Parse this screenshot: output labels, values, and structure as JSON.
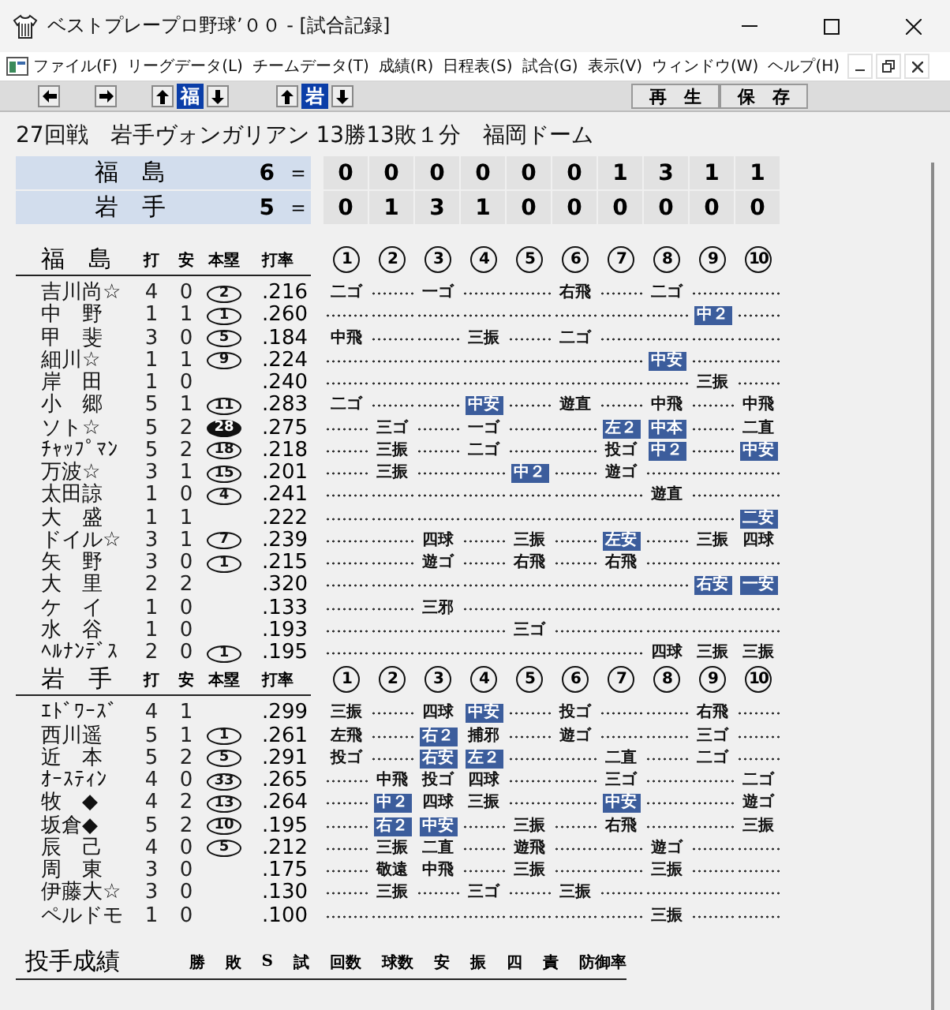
{
  "window": {
    "title": "ベストプレープロ野球’００ - [試合記録]"
  },
  "menu": [
    "ファイル(F)",
    "リーグデータ(L)",
    "チームデータ(T)",
    "成績(R)",
    "日程表(S)",
    "試合(G)",
    "表示(V)",
    "ウィンドウ(W)",
    "ヘルプ(H)"
  ],
  "toolbar": {
    "team_buttons": [
      "福",
      "岩"
    ],
    "actions": [
      "再　生",
      "保　存"
    ]
  },
  "game_info": "27回戦　岩手ヴォンガリアン 13勝13敗１分　福岡ドーム",
  "scoreboard": [
    {
      "team": "福　島",
      "runs": "6",
      "equals": "＝",
      "innings": [
        "0",
        "0",
        "0",
        "0",
        "0",
        "0",
        "1",
        "3",
        "1",
        "1"
      ]
    },
    {
      "team": "岩　手",
      "runs": "5",
      "equals": "＝",
      "innings": [
        "0",
        "1",
        "3",
        "1",
        "0",
        "0",
        "0",
        "0",
        "0",
        "0"
      ]
    }
  ],
  "batting": [
    {
      "team": "福　島",
      "columns": [
        "打",
        "安",
        "本塁",
        "打率"
      ],
      "innings": [
        "1",
        "2",
        "3",
        "4",
        "5",
        "6",
        "7",
        "8",
        "9",
        "10"
      ],
      "rows": [
        {
          "name": "吉川尚☆",
          "ab": "4",
          "h": "0",
          "hr": {
            "text": "2",
            "filled": false
          },
          "avg": ".216",
          "plays": [
            {
              "kind": "play",
              "text": "二ゴ",
              "hit": false
            },
            {
              "kind": "dots"
            },
            {
              "kind": "play",
              "text": "一ゴ",
              "hit": false
            },
            {
              "kind": "dots"
            },
            {
              "kind": "dots"
            },
            {
              "kind": "play",
              "text": "右飛",
              "hit": false
            },
            {
              "kind": "dots"
            },
            {
              "kind": "play",
              "text": "二ゴ",
              "hit": false
            },
            {
              "kind": "dots"
            },
            {
              "kind": "dots"
            }
          ]
        },
        {
          "name": "中　野",
          "ab": "1",
          "h": "1",
          "hr": {
            "text": "1",
            "filled": false
          },
          "avg": ".260",
          "plays": [
            {
              "kind": "dots"
            },
            {
              "kind": "dots"
            },
            {
              "kind": "dots"
            },
            {
              "kind": "dots"
            },
            {
              "kind": "dots"
            },
            {
              "kind": "dots"
            },
            {
              "kind": "dots"
            },
            {
              "kind": "dots"
            },
            {
              "kind": "play",
              "text": "中２",
              "hit": true
            },
            {
              "kind": "dots"
            }
          ]
        },
        {
          "name": "甲　斐",
          "ab": "3",
          "h": "0",
          "hr": {
            "text": "5",
            "filled": false
          },
          "avg": ".184",
          "plays": [
            {
              "kind": "play",
              "text": "中飛",
              "hit": false
            },
            {
              "kind": "dots"
            },
            {
              "kind": "dots"
            },
            {
              "kind": "play",
              "text": "三振",
              "hit": false
            },
            {
              "kind": "dots"
            },
            {
              "kind": "play",
              "text": "二ゴ",
              "hit": false
            },
            {
              "kind": "dots"
            },
            {
              "kind": "dots"
            },
            {
              "kind": "dots"
            },
            {
              "kind": "dots"
            }
          ]
        },
        {
          "name": "細川☆",
          "ab": "1",
          "h": "1",
          "hr": {
            "text": "9",
            "filled": false
          },
          "avg": ".224",
          "plays": [
            {
              "kind": "dots"
            },
            {
              "kind": "dots"
            },
            {
              "kind": "dots"
            },
            {
              "kind": "dots"
            },
            {
              "kind": "dots"
            },
            {
              "kind": "dots"
            },
            {
              "kind": "dots"
            },
            {
              "kind": "play",
              "text": "中安",
              "hit": true
            },
            {
              "kind": "dots"
            },
            {
              "kind": "dots"
            }
          ]
        },
        {
          "name": "岸　田",
          "ab": "1",
          "h": "0",
          "avg": ".240",
          "plays": [
            {
              "kind": "dots"
            },
            {
              "kind": "dots"
            },
            {
              "kind": "dots"
            },
            {
              "kind": "dots"
            },
            {
              "kind": "dots"
            },
            {
              "kind": "dots"
            },
            {
              "kind": "dots"
            },
            {
              "kind": "dots"
            },
            {
              "kind": "play",
              "text": "三振",
              "hit": false
            },
            {
              "kind": "dots"
            }
          ]
        },
        {
          "name": "小　郷",
          "ab": "5",
          "h": "1",
          "hr": {
            "text": "11",
            "filled": false
          },
          "avg": ".283",
          "plays": [
            {
              "kind": "play",
              "text": "二ゴ",
              "hit": false
            },
            {
              "kind": "dots"
            },
            {
              "kind": "dots"
            },
            {
              "kind": "play",
              "text": "中安",
              "hit": true
            },
            {
              "kind": "dots"
            },
            {
              "kind": "play",
              "text": "遊直",
              "hit": false
            },
            {
              "kind": "dots"
            },
            {
              "kind": "play",
              "text": "中飛",
              "hit": false
            },
            {
              "kind": "dots"
            },
            {
              "kind": "play",
              "text": "中飛",
              "hit": false
            }
          ]
        },
        {
          "name": "ソト☆",
          "ab": "5",
          "h": "2",
          "hr": {
            "text": "28",
            "filled": true
          },
          "avg": ".275",
          "plays": [
            {
              "kind": "dots"
            },
            {
              "kind": "play",
              "text": "三ゴ",
              "hit": false
            },
            {
              "kind": "dots"
            },
            {
              "kind": "play",
              "text": "一ゴ",
              "hit": false
            },
            {
              "kind": "dots"
            },
            {
              "kind": "dots"
            },
            {
              "kind": "play",
              "text": "左２",
              "hit": true
            },
            {
              "kind": "play",
              "text": "中本",
              "hit": true
            },
            {
              "kind": "dots"
            },
            {
              "kind": "play",
              "text": "二直",
              "hit": false
            }
          ]
        },
        {
          "name": "ﾁｬｯﾌﾟﾏﾝ",
          "ab": "5",
          "h": "2",
          "hr": {
            "text": "18",
            "filled": false
          },
          "avg": ".218",
          "plays": [
            {
              "kind": "dots"
            },
            {
              "kind": "play",
              "text": "三振",
              "hit": false
            },
            {
              "kind": "dots"
            },
            {
              "kind": "play",
              "text": "二ゴ",
              "hit": false
            },
            {
              "kind": "dots"
            },
            {
              "kind": "dots"
            },
            {
              "kind": "play",
              "text": "投ゴ",
              "hit": false
            },
            {
              "kind": "play",
              "text": "中２",
              "hit": true
            },
            {
              "kind": "dots"
            },
            {
              "kind": "play",
              "text": "中安",
              "hit": true
            }
          ]
        },
        {
          "name": "万波☆",
          "ab": "3",
          "h": "1",
          "hr": {
            "text": "15",
            "filled": false
          },
          "avg": ".201",
          "plays": [
            {
              "kind": "dots"
            },
            {
              "kind": "play",
              "text": "三振",
              "hit": false
            },
            {
              "kind": "dots"
            },
            {
              "kind": "dots"
            },
            {
              "kind": "play",
              "text": "中２",
              "hit": true
            },
            {
              "kind": "dots"
            },
            {
              "kind": "play",
              "text": "遊ゴ",
              "hit": false
            },
            {
              "kind": "dots"
            },
            {
              "kind": "dots"
            },
            {
              "kind": "dots"
            }
          ]
        },
        {
          "name": "太田諒",
          "ab": "1",
          "h": "0",
          "hr": {
            "text": "4",
            "filled": false
          },
          "avg": ".241",
          "plays": [
            {
              "kind": "dots"
            },
            {
              "kind": "dots"
            },
            {
              "kind": "dots"
            },
            {
              "kind": "dots"
            },
            {
              "kind": "dots"
            },
            {
              "kind": "dots"
            },
            {
              "kind": "dots"
            },
            {
              "kind": "play",
              "text": "遊直",
              "hit": false
            },
            {
              "kind": "dots"
            },
            {
              "kind": "dots"
            }
          ]
        },
        {
          "name": "大　盛",
          "ab": "1",
          "h": "1",
          "avg": ".222",
          "plays": [
            {
              "kind": "dots"
            },
            {
              "kind": "dots"
            },
            {
              "kind": "dots"
            },
            {
              "kind": "dots"
            },
            {
              "kind": "dots"
            },
            {
              "kind": "dots"
            },
            {
              "kind": "dots"
            },
            {
              "kind": "dots"
            },
            {
              "kind": "dots"
            },
            {
              "kind": "play",
              "text": "二安",
              "hit": true
            }
          ]
        },
        {
          "name": "ドイル☆",
          "ab": "3",
          "h": "1",
          "hr": {
            "text": "7",
            "filled": false
          },
          "avg": ".239",
          "plays": [
            {
              "kind": "dots"
            },
            {
              "kind": "dots"
            },
            {
              "kind": "play",
              "text": "四球",
              "hit": false
            },
            {
              "kind": "dots"
            },
            {
              "kind": "play",
              "text": "三振",
              "hit": false
            },
            {
              "kind": "dots"
            },
            {
              "kind": "play",
              "text": "左安",
              "hit": true
            },
            {
              "kind": "dots"
            },
            {
              "kind": "play",
              "text": "三振",
              "hit": false
            },
            {
              "kind": "play",
              "text": "四球",
              "hit": false
            }
          ]
        },
        {
          "name": "矢　野",
          "ab": "3",
          "h": "0",
          "hr": {
            "text": "1",
            "filled": false
          },
          "avg": ".215",
          "plays": [
            {
              "kind": "dots"
            },
            {
              "kind": "dots"
            },
            {
              "kind": "play",
              "text": "遊ゴ",
              "hit": false
            },
            {
              "kind": "dots"
            },
            {
              "kind": "play",
              "text": "右飛",
              "hit": false
            },
            {
              "kind": "dots"
            },
            {
              "kind": "play",
              "text": "右飛",
              "hit": false
            },
            {
              "kind": "dots"
            },
            {
              "kind": "dots"
            },
            {
              "kind": "dots"
            }
          ]
        },
        {
          "name": "大　里",
          "ab": "2",
          "h": "2",
          "avg": ".320",
          "plays": [
            {
              "kind": "dots"
            },
            {
              "kind": "dots"
            },
            {
              "kind": "dots"
            },
            {
              "kind": "dots"
            },
            {
              "kind": "dots"
            },
            {
              "kind": "dots"
            },
            {
              "kind": "dots"
            },
            {
              "kind": "dots"
            },
            {
              "kind": "play",
              "text": "右安",
              "hit": true
            },
            {
              "kind": "play",
              "text": "一安",
              "hit": true
            }
          ]
        },
        {
          "name": "ケ　イ",
          "ab": "1",
          "h": "0",
          "avg": ".133",
          "plays": [
            {
              "kind": "dots"
            },
            {
              "kind": "dots"
            },
            {
              "kind": "play",
              "text": "三邪",
              "hit": false
            },
            {
              "kind": "dots"
            },
            {
              "kind": "dots"
            },
            {
              "kind": "dots"
            },
            {
              "kind": "dots"
            },
            {
              "kind": "dots"
            },
            {
              "kind": "dots"
            },
            {
              "kind": "dots"
            }
          ]
        },
        {
          "name": "水　谷",
          "ab": "1",
          "h": "0",
          "avg": ".193",
          "plays": [
            {
              "kind": "dots"
            },
            {
              "kind": "dots"
            },
            {
              "kind": "dots"
            },
            {
              "kind": "dots"
            },
            {
              "kind": "play",
              "text": "三ゴ",
              "hit": false
            },
            {
              "kind": "dots"
            },
            {
              "kind": "dots"
            },
            {
              "kind": "dots"
            },
            {
              "kind": "dots"
            },
            {
              "kind": "dots"
            }
          ]
        },
        {
          "name": "ﾍﾙﾅﾝﾃﾞｽ",
          "ab": "2",
          "h": "0",
          "hr": {
            "text": "1",
            "filled": false
          },
          "avg": ".195",
          "plays": [
            {
              "kind": "dots"
            },
            {
              "kind": "dots"
            },
            {
              "kind": "dots"
            },
            {
              "kind": "dots"
            },
            {
              "kind": "dots"
            },
            {
              "kind": "dots"
            },
            {
              "kind": "dots"
            },
            {
              "kind": "play",
              "text": "四球",
              "hit": false
            },
            {
              "kind": "play",
              "text": "三振",
              "hit": false
            },
            {
              "kind": "play",
              "text": "三振",
              "hit": false
            }
          ]
        }
      ]
    },
    {
      "team": "岩　手",
      "columns": [
        "打",
        "安",
        "本塁",
        "打率"
      ],
      "innings": [
        "1",
        "2",
        "3",
        "4",
        "5",
        "6",
        "7",
        "8",
        "9",
        "10"
      ],
      "rows": [
        {
          "name": "ｴﾄﾞﾜｰｽﾞ",
          "ab": "4",
          "h": "1",
          "avg": ".299",
          "plays": [
            {
              "kind": "play",
              "text": "三振",
              "hit": false
            },
            {
              "kind": "dots"
            },
            {
              "kind": "play",
              "text": "四球",
              "hit": false
            },
            {
              "kind": "play",
              "text": "中安",
              "hit": true
            },
            {
              "kind": "dots"
            },
            {
              "kind": "play",
              "text": "投ゴ",
              "hit": false
            },
            {
              "kind": "dots"
            },
            {
              "kind": "dots"
            },
            {
              "kind": "play",
              "text": "右飛",
              "hit": false
            },
            {
              "kind": "dots"
            }
          ]
        },
        {
          "name": "西川遥",
          "ab": "5",
          "h": "1",
          "hr": {
            "text": "1",
            "filled": false
          },
          "avg": ".261",
          "plays": [
            {
              "kind": "play",
              "text": "左飛",
              "hit": false
            },
            {
              "kind": "dots"
            },
            {
              "kind": "play",
              "text": "右２",
              "hit": true
            },
            {
              "kind": "play",
              "text": "捕邪",
              "hit": false
            },
            {
              "kind": "dots"
            },
            {
              "kind": "play",
              "text": "遊ゴ",
              "hit": false
            },
            {
              "kind": "dots"
            },
            {
              "kind": "dots"
            },
            {
              "kind": "play",
              "text": "三ゴ",
              "hit": false
            },
            {
              "kind": "dots"
            }
          ]
        },
        {
          "name": "近　本",
          "ab": "5",
          "h": "2",
          "hr": {
            "text": "5",
            "filled": false
          },
          "avg": ".291",
          "plays": [
            {
              "kind": "play",
              "text": "投ゴ",
              "hit": false
            },
            {
              "kind": "dots"
            },
            {
              "kind": "play",
              "text": "右安",
              "hit": true
            },
            {
              "kind": "play",
              "text": "左２",
              "hit": true
            },
            {
              "kind": "dots"
            },
            {
              "kind": "dots"
            },
            {
              "kind": "play",
              "text": "二直",
              "hit": false
            },
            {
              "kind": "dots"
            },
            {
              "kind": "play",
              "text": "二ゴ",
              "hit": false
            },
            {
              "kind": "dots"
            }
          ]
        },
        {
          "name": "ｵｰｽﾃｨﾝ",
          "ab": "4",
          "h": "0",
          "hr": {
            "text": "33",
            "filled": false
          },
          "avg": ".265",
          "plays": [
            {
              "kind": "dots"
            },
            {
              "kind": "play",
              "text": "中飛",
              "hit": false
            },
            {
              "kind": "play",
              "text": "投ゴ",
              "hit": false
            },
            {
              "kind": "play",
              "text": "四球",
              "hit": false
            },
            {
              "kind": "dots"
            },
            {
              "kind": "dots"
            },
            {
              "kind": "play",
              "text": "三ゴ",
              "hit": false
            },
            {
              "kind": "dots"
            },
            {
              "kind": "dots"
            },
            {
              "kind": "play",
              "text": "二ゴ",
              "hit": false
            }
          ]
        },
        {
          "name": "牧　◆",
          "ab": "4",
          "h": "2",
          "hr": {
            "text": "13",
            "filled": false
          },
          "avg": ".264",
          "plays": [
            {
              "kind": "dots"
            },
            {
              "kind": "play",
              "text": "中２",
              "hit": true
            },
            {
              "kind": "play",
              "text": "四球",
              "hit": false
            },
            {
              "kind": "play",
              "text": "三振",
              "hit": false
            },
            {
              "kind": "dots"
            },
            {
              "kind": "dots"
            },
            {
              "kind": "play",
              "text": "中安",
              "hit": true
            },
            {
              "kind": "dots"
            },
            {
              "kind": "dots"
            },
            {
              "kind": "play",
              "text": "遊ゴ",
              "hit": false
            }
          ]
        },
        {
          "name": "坂倉◆",
          "ab": "5",
          "h": "2",
          "hr": {
            "text": "10",
            "filled": false
          },
          "avg": ".195",
          "plays": [
            {
              "kind": "dots"
            },
            {
              "kind": "play",
              "text": "右２",
              "hit": true
            },
            {
              "kind": "play",
              "text": "中安",
              "hit": true
            },
            {
              "kind": "dots"
            },
            {
              "kind": "play",
              "text": "三振",
              "hit": false
            },
            {
              "kind": "dots"
            },
            {
              "kind": "play",
              "text": "右飛",
              "hit": false
            },
            {
              "kind": "dots"
            },
            {
              "kind": "dots"
            },
            {
              "kind": "play",
              "text": "三振",
              "hit": false
            }
          ]
        },
        {
          "name": "辰　己",
          "ab": "4",
          "h": "0",
          "hr": {
            "text": "5",
            "filled": false
          },
          "avg": ".212",
          "plays": [
            {
              "kind": "dots"
            },
            {
              "kind": "play",
              "text": "三振",
              "hit": false
            },
            {
              "kind": "play",
              "text": "二直",
              "hit": false
            },
            {
              "kind": "dots"
            },
            {
              "kind": "play",
              "text": "遊飛",
              "hit": false
            },
            {
              "kind": "dots"
            },
            {
              "kind": "dots"
            },
            {
              "kind": "play",
              "text": "遊ゴ",
              "hit": false
            },
            {
              "kind": "dots"
            },
            {
              "kind": "dots"
            }
          ]
        },
        {
          "name": "周　東",
          "ab": "3",
          "h": "0",
          "avg": ".175",
          "plays": [
            {
              "kind": "dots"
            },
            {
              "kind": "play",
              "text": "敬遠",
              "hit": false
            },
            {
              "kind": "play",
              "text": "中飛",
              "hit": false
            },
            {
              "kind": "dots"
            },
            {
              "kind": "play",
              "text": "三振",
              "hit": false
            },
            {
              "kind": "dots"
            },
            {
              "kind": "dots"
            },
            {
              "kind": "play",
              "text": "三振",
              "hit": false
            },
            {
              "kind": "dots"
            },
            {
              "kind": "dots"
            }
          ]
        },
        {
          "name": "伊藤大☆",
          "ab": "3",
          "h": "0",
          "avg": ".130",
          "plays": [
            {
              "kind": "dots"
            },
            {
              "kind": "play",
              "text": "三振",
              "hit": false
            },
            {
              "kind": "dots"
            },
            {
              "kind": "play",
              "text": "三ゴ",
              "hit": false
            },
            {
              "kind": "dots"
            },
            {
              "kind": "play",
              "text": "三振",
              "hit": false
            },
            {
              "kind": "dots"
            },
            {
              "kind": "dots"
            },
            {
              "kind": "dots"
            },
            {
              "kind": "dots"
            }
          ]
        },
        {
          "name": "ペルドモ",
          "ab": "1",
          "h": "0",
          "avg": ".100",
          "plays": [
            {
              "kind": "dots"
            },
            {
              "kind": "dots"
            },
            {
              "kind": "dots"
            },
            {
              "kind": "dots"
            },
            {
              "kind": "dots"
            },
            {
              "kind": "dots"
            },
            {
              "kind": "dots"
            },
            {
              "kind": "play",
              "text": "三振",
              "hit": false
            },
            {
              "kind": "dots"
            },
            {
              "kind": "dots"
            }
          ]
        }
      ]
    }
  ],
  "pitching": {
    "title": "投手成績",
    "columns": [
      "勝",
      "敗",
      "S",
      "試",
      "回数",
      "球数",
      "安",
      "振",
      "四",
      "責",
      "防御率"
    ]
  }
}
